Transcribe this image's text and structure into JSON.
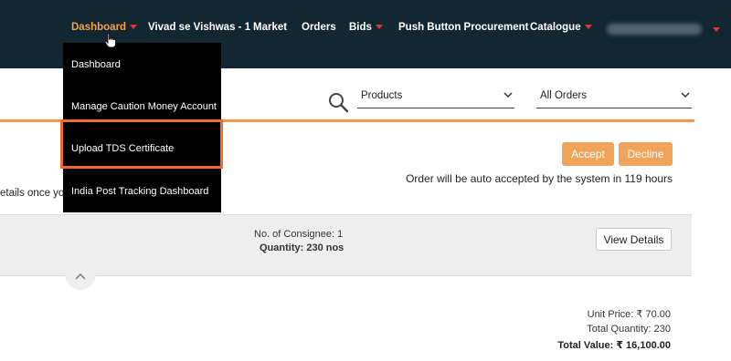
{
  "nav": {
    "items": [
      {
        "label": "Dashboard",
        "caret": true,
        "active": true
      },
      {
        "label": "Vivad se Vishwas - 1",
        "caret": false
      },
      {
        "label": "Market",
        "caret": false
      },
      {
        "label": "Orders",
        "caret": false
      },
      {
        "label": "Bids",
        "caret": true
      },
      {
        "label": "Push Button Procurement",
        "caret": false
      },
      {
        "label": "Catalogue",
        "caret": true
      }
    ]
  },
  "dropdown": {
    "items": [
      "Dashboard",
      "Manage Caution Money Account",
      "Upload TDS Certificate",
      "India Post Tracking Dashboard"
    ],
    "highlighted_index": 2
  },
  "filters": {
    "product_select": "Products",
    "order_select": "All Orders"
  },
  "order": {
    "accept_label": "Accept",
    "decline_label": "Decline",
    "auto_accept_text": "Order will be auto accepted by the system in 119 hours",
    "details_text": "etails once you",
    "consignee_text": "No. of Consignee: 1",
    "quantity_text": "Quantity: 230 nos",
    "view_details_label": "View Details"
  },
  "pricing": {
    "unit_price": "Unit Price: ₹ 70.00",
    "total_quantity": "Total Quantity: 230",
    "total_value": "Total Value: ₹ 16,100.00"
  },
  "colors": {
    "nav_bg": "#132732",
    "accent_orange": "#f0a45a",
    "active_nav": "#f2a44b",
    "caret_red": "#e0362c",
    "highlight_border": "#ef6a2b"
  }
}
